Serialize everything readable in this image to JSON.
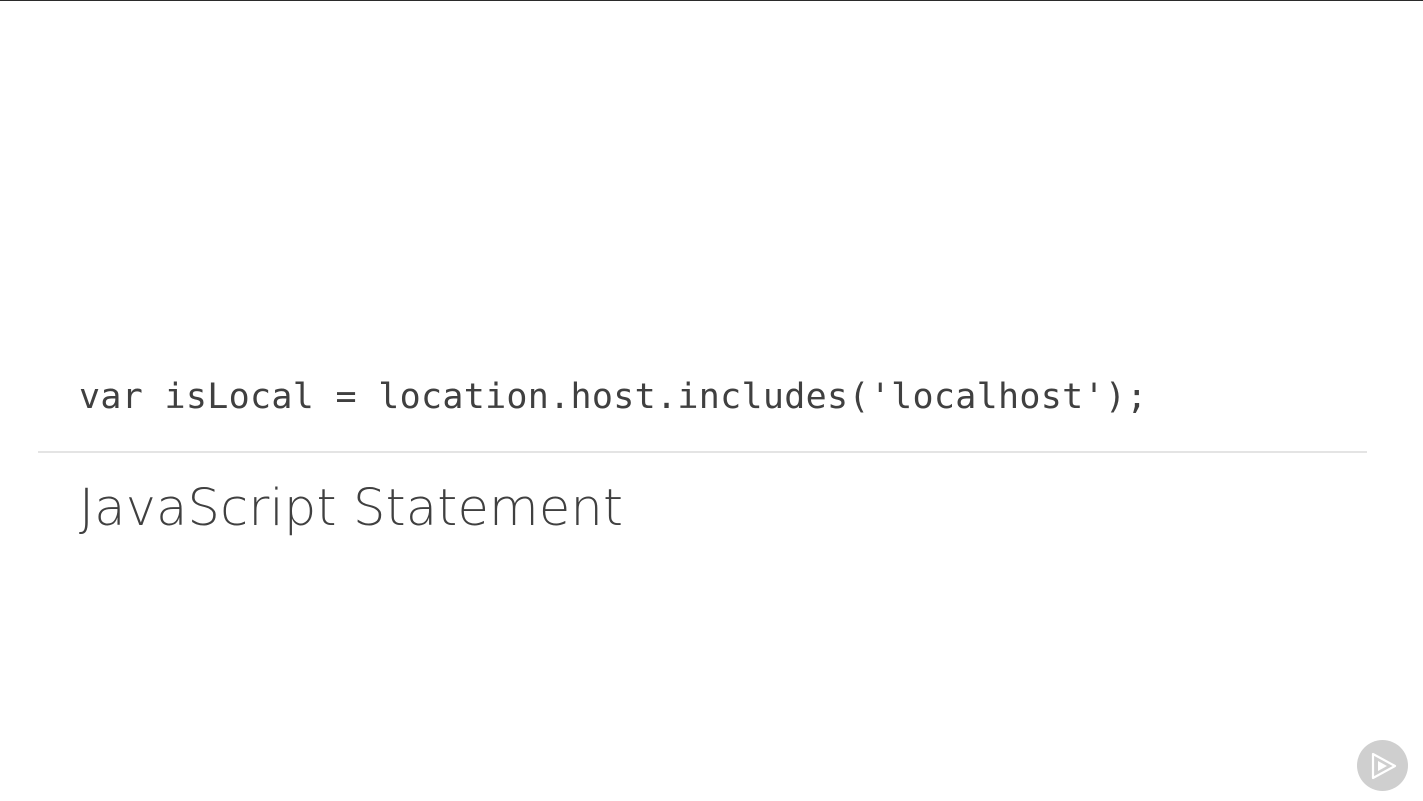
{
  "slide": {
    "code": "var isLocal = location.host.includes('localhost');",
    "title": "JavaScript Statement"
  },
  "branding": {
    "logo_icon": "pluralsight-play-logo-icon"
  },
  "colors": {
    "background": "#ffffff",
    "text": "#404040",
    "divider": "#e4e4e4",
    "logo": "#cfcfcf"
  }
}
